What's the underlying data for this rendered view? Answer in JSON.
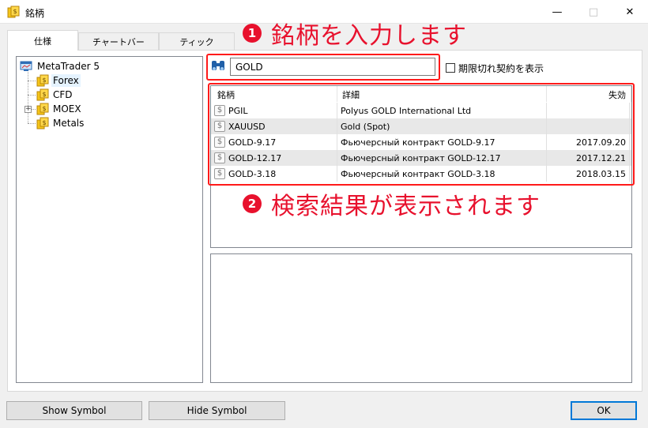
{
  "window": {
    "title": "銘柄"
  },
  "tabs": [
    {
      "label": "仕様"
    },
    {
      "label": "チャートバー"
    },
    {
      "label": "ティック"
    }
  ],
  "tree": {
    "root": "MetaTrader 5",
    "items": [
      {
        "label": "Forex",
        "selected": true
      },
      {
        "label": "CFD"
      },
      {
        "label": "MOEX",
        "expandable": true
      },
      {
        "label": "Metals"
      }
    ]
  },
  "search": {
    "value": "GOLD"
  },
  "expired_checkbox": {
    "label": "期限切れ契約を表示",
    "checked": false
  },
  "table": {
    "columns": [
      "銘柄",
      "詳細",
      "失効"
    ],
    "rows": [
      {
        "symbol": "PGIL",
        "detail": "Polyus GOLD International Ltd",
        "expiry": ""
      },
      {
        "symbol": "XAUUSD",
        "detail": "Gold (Spot)",
        "expiry": ""
      },
      {
        "symbol": "GOLD-9.17",
        "detail": "Фьючерсный контракт GOLD-9.17",
        "expiry": "2017.09.20"
      },
      {
        "symbol": "GOLD-12.17",
        "detail": "Фьючерсный контракт GOLD-12.17",
        "expiry": "2017.12.21"
      },
      {
        "symbol": "GOLD-3.18",
        "detail": "Фьючерсный контракт GOLD-3.18",
        "expiry": "2018.03.15"
      }
    ]
  },
  "buttons": {
    "show_symbol": "Show Symbol",
    "hide_symbol": "Hide Symbol",
    "ok": "OK"
  },
  "annotations": {
    "step1": {
      "number": "1",
      "text": "銘柄を入力します"
    },
    "step2": {
      "number": "2",
      "text": "検索結果が表示されます"
    }
  },
  "colors": {
    "annotation": "#e8112d",
    "highlight_box": "#ff1a1a"
  }
}
